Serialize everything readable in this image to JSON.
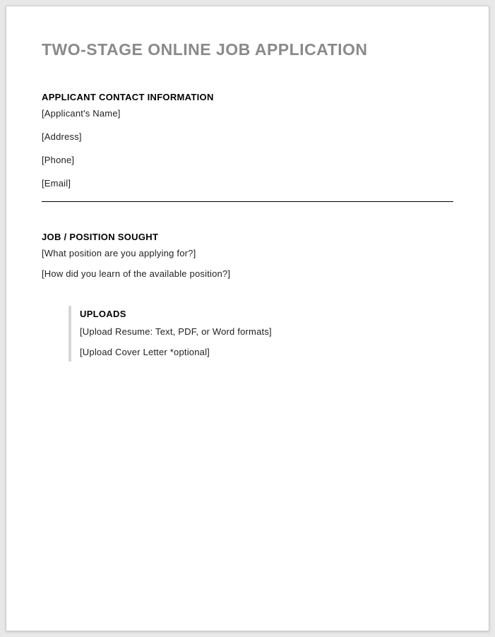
{
  "title": "TWO-STAGE ONLINE JOB APPLICATION",
  "contact": {
    "header": "APPLICANT CONTACT INFORMATION",
    "fields": {
      "name": "[Applicant's Name]",
      "address": "[Address]",
      "phone": "[Phone]",
      "email": "[Email]"
    }
  },
  "position": {
    "header": "JOB / POSITION SOUGHT",
    "fields": {
      "what": "[What position are you applying for?]",
      "how": "[How did you learn of the available position?]"
    }
  },
  "uploads": {
    "header": "UPLOADS",
    "fields": {
      "resume": "[Upload Resume: Text, PDF, or Word formats]",
      "cover": "[Upload Cover Letter *optional]"
    }
  }
}
